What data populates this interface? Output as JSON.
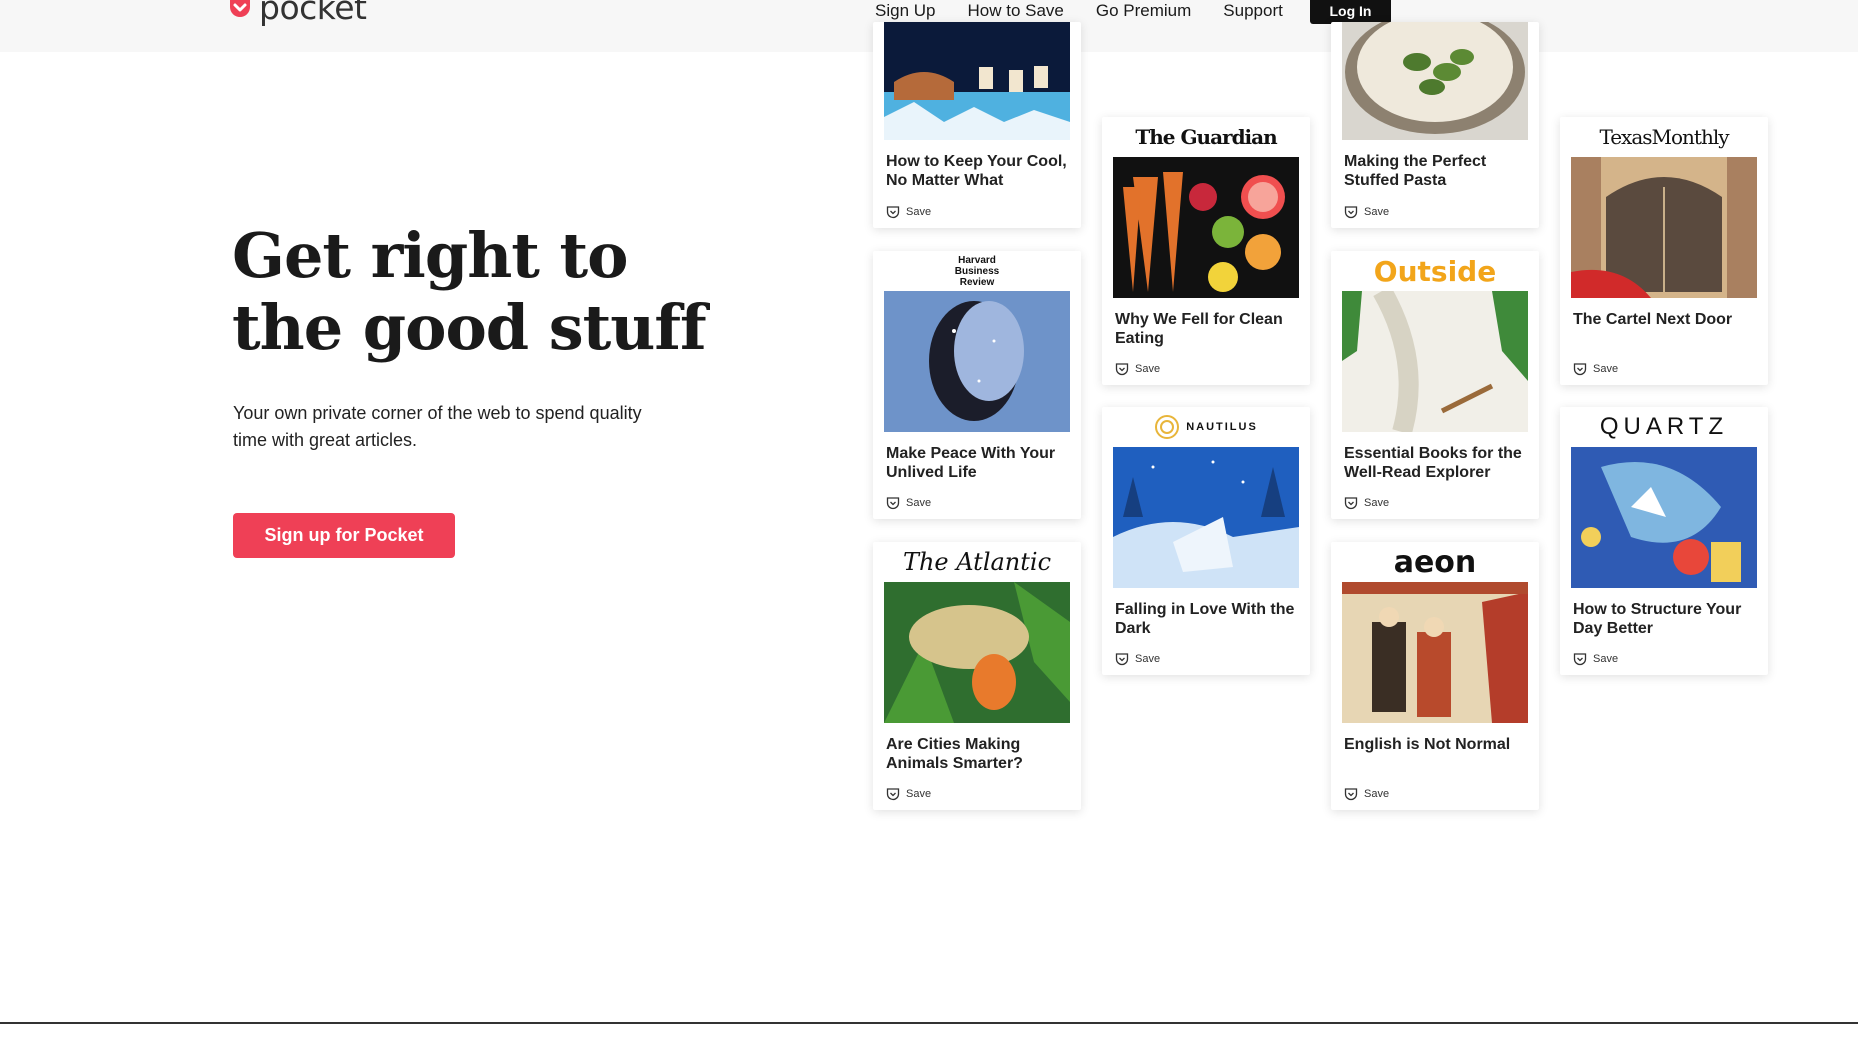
{
  "header": {
    "logo_text": "pocket",
    "nav": [
      "Sign Up",
      "How to Save",
      "Go Premium",
      "Support"
    ],
    "login": "Log In"
  },
  "hero": {
    "title_lines": [
      "Get right to",
      "the good stuff"
    ],
    "subtitle_lines": [
      "Your own private corner of the web to spend quality",
      "time with great articles."
    ],
    "cta": "Sign up for Pocket"
  },
  "colors": {
    "brand": "#ef4056",
    "header_bg": "#f7f7f7",
    "login_bg": "#111111"
  },
  "cards": [
    {
      "publication": "",
      "title": "How to Keep Your Cool, No Matter What",
      "save": "Save",
      "icon": "save-pocket-icon"
    },
    {
      "publication": "Harvard Business Review",
      "title": "Make Peace With Your Unlived Life",
      "save": "Save",
      "icon": "save-pocket-icon"
    },
    {
      "publication": "The Atlantic",
      "title": "Are Cities Making Animals Smarter?",
      "save": "Save",
      "icon": "save-pocket-icon"
    },
    {
      "publication": "The Guardian",
      "title": "Why We Fell for Clean Eating",
      "save": "Save",
      "icon": "save-pocket-icon"
    },
    {
      "publication": "NAUTILUS",
      "title": "Falling in Love With the Dark",
      "save": "Save",
      "icon": "save-pocket-icon"
    },
    {
      "publication": "",
      "title": "Making the Perfect Stuffed Pasta",
      "save": "Save",
      "icon": "save-pocket-icon"
    },
    {
      "publication": "Outside",
      "title": "Essential Books for the Well-Read Explorer",
      "save": "Save",
      "icon": "save-pocket-icon"
    },
    {
      "publication": "aeon",
      "title": "English is Not Normal",
      "save": "Save",
      "icon": "save-pocket-icon"
    },
    {
      "publication": "TexasMonthly",
      "title": "The Cartel Next Door",
      "save": "Save",
      "icon": "save-pocket-icon"
    },
    {
      "publication": "QUARTZ",
      "title": "How to Structure Your Day Better",
      "save": "Save",
      "icon": "save-pocket-icon"
    }
  ]
}
